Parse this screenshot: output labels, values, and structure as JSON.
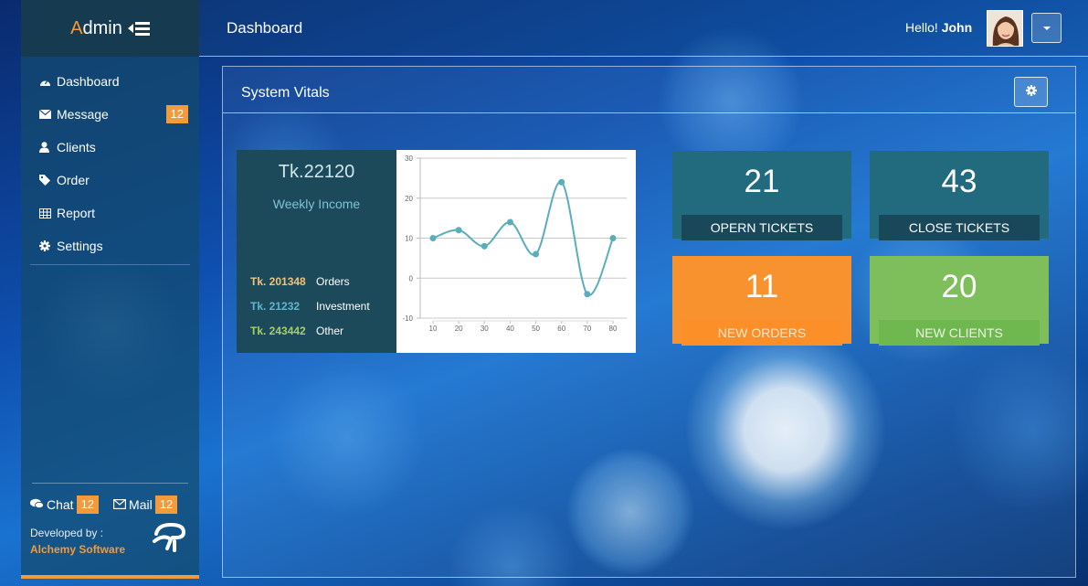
{
  "brand": {
    "first_letter": "A",
    "rest": "dmin"
  },
  "header": {
    "title": "Dashboard",
    "greeting": "Hello!",
    "user_name": "John"
  },
  "sidebar": {
    "items": [
      {
        "label": "Dashboard",
        "icon": "dashboard-icon"
      },
      {
        "label": "Message",
        "icon": "envelope-icon",
        "badge": "12"
      },
      {
        "label": "Clients",
        "icon": "user-icon"
      },
      {
        "label": "Order",
        "icon": "tag-icon"
      },
      {
        "label": "Report",
        "icon": "table-icon"
      },
      {
        "label": "Settings",
        "icon": "gear-icon"
      }
    ],
    "chat": {
      "label": "Chat",
      "badge": "12"
    },
    "mail": {
      "label": "Mail",
      "badge": "12"
    },
    "developed_by": "Developed by :",
    "company": "Alchemy Software"
  },
  "panel": {
    "title": "System Vitals"
  },
  "income": {
    "amount": "Tk.22120",
    "label": "Weekly Income",
    "rows": [
      {
        "value": "Tk. 201348",
        "label": "Orders",
        "color": "#f0c27a"
      },
      {
        "value": "Tk. 21232",
        "label": "Investment",
        "color": "#5fb6d0"
      },
      {
        "value": "Tk. 243442",
        "label": "Other",
        "color": "#a6cf6a"
      }
    ]
  },
  "tiles": [
    {
      "number": "21",
      "label": "OPERN TICKETS",
      "style": "teal"
    },
    {
      "number": "43",
      "label": "CLOSE TICKETS",
      "style": "teal"
    },
    {
      "number": "11",
      "label": "NEW ORDERS",
      "style": "orange"
    },
    {
      "number": "20",
      "label": "NEW CLIENTS",
      "style": "green"
    }
  ],
  "colors": {
    "accent": "#f39a3a",
    "line": "#5aadbb",
    "teal_tile": "#226a7e",
    "orange_tile": "#f8922e",
    "green_tile": "#7ebf5c"
  },
  "chart_data": {
    "type": "line",
    "x": [
      10,
      20,
      30,
      40,
      50,
      60,
      70,
      80
    ],
    "series": [
      {
        "values": [
          10,
          12,
          8,
          14,
          6,
          24,
          -4,
          10
        ]
      }
    ],
    "ylim": [
      -10,
      30
    ],
    "yticks": [
      -10,
      0,
      10,
      20,
      30
    ],
    "xticks": [
      10,
      20,
      30,
      40,
      50,
      60,
      70,
      80
    ],
    "grid": true
  }
}
